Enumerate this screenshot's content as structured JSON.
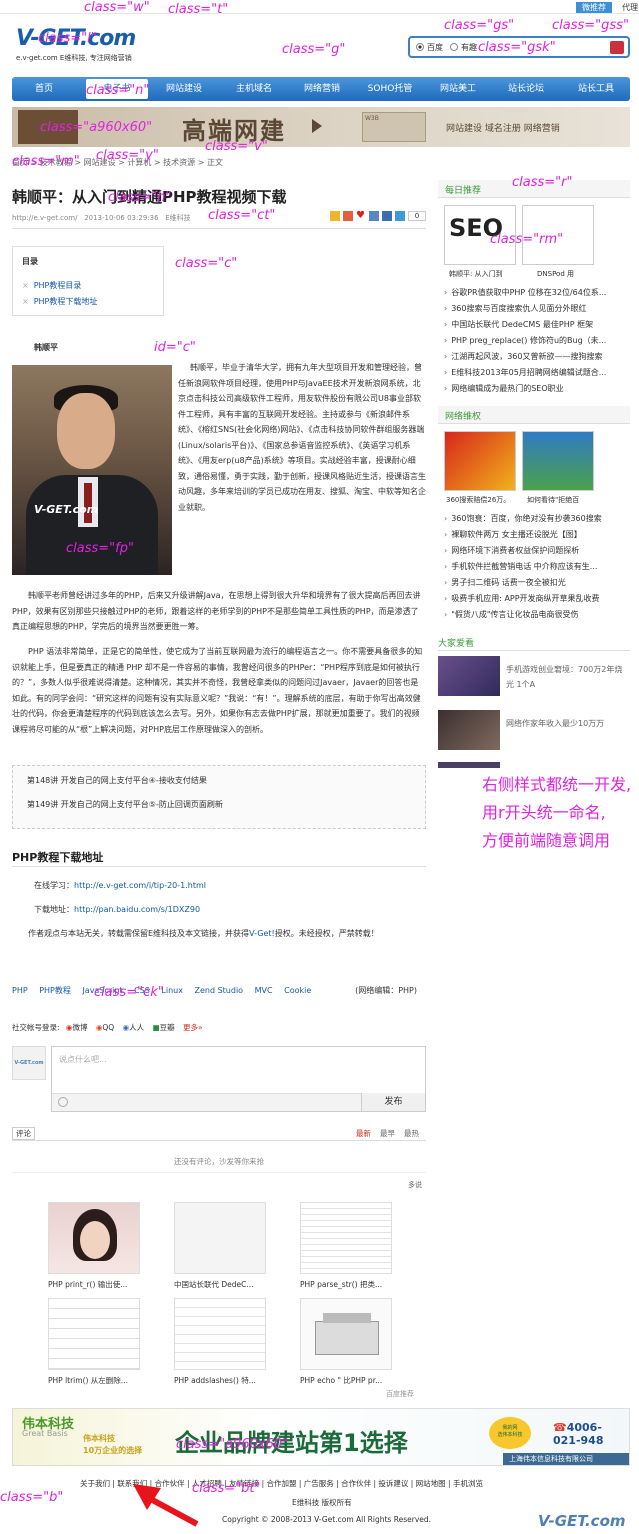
{
  "topbar": {
    "link1": "微推荐",
    "link2": "代理"
  },
  "header": {
    "logo_text": "V-GET.com",
    "tagline": "e.v-get.com E维科技, 专注网络营销",
    "search": {
      "opt1": "百度",
      "opt2": "有趣"
    }
  },
  "nav": [
    "首页",
    "电子书",
    "网站建设",
    "主机域名",
    "网络营销",
    "SOHO托管",
    "网站美工",
    "站长论坛",
    "站长工具"
  ],
  "banner": {
    "big": "高端网建",
    "small": "网站建设 域名注册 网络营销",
    "w3": "W3B"
  },
  "breadcrumb": "首页 > 技术教程 > 网站建设 > 计算机 > 技术资源 > 正文",
  "article": {
    "title": "韩顺平：从入门到精通PHP教程视频下载",
    "meta_url": "http://e.v-get.com/",
    "meta_time": "2013-10-06 03:29:36",
    "meta_source": "E维科技",
    "share_count": "0",
    "toc": {
      "heading": "目录",
      "items": [
        "PHP教程目录",
        "PHP教程下载地址"
      ]
    },
    "author": "韩顺平",
    "photo_watermark": "V-GET.com",
    "intro": "韩顺平，毕业于清华大学，拥有九年大型项目开发和管理经验，曾任新浪网软件项目经理，使用PHP与JavaEE技术开发新浪网系统，北京点击科技公司高级软件工程师，用友软件股份有限公司U8事业部软件工程师，具有丰富的互联网开发经验。主持或参与《新浪邮件系统》、《榕红SNS(社会化网络)网站》、《点击科技协同软件群组服务器端(Linux/solaris平台)》、《国家总参语音监控系统》、《英语学习机系统》、《用友erp(u8产品)系统》等项目。实战经验丰富，授课耐心细致，通俗易懂，勇于实践，勤于创新，授课风格贴近生活，授课语言生动风趣，多年来培训的学员已成功在用友、搜狐、淘宝、中软等知名企业就职。",
    "p2": "韩顺平老师曾经讲过多年的PHP，后来又升级讲解Java，在思想上得到很大升华和境界有了很大提高后再回去讲PHP，效果有区别那些只接触过PHP的老师，跟着这样的老师学到的PHP不是那些简单工具性质的PHP，而是渗透了真正编程思想的PHP，学完后的境界当然要更胜一筹。",
    "p3": "PHP 语法非常简单，正是它的简单性，使它成为了当前互联网最为流行的编程语言之一。你不需要具备很多的知识就能上手，但是要真正的精通 PHP 却不是一件容易的事情，我曾经问很多的PHPer：“PHP程序到底是如何被执行的？”，多数人似乎很难说得清楚。这种情况，其实并不奇怪，我曾经拿类似的问题问过Javaer，Javaer的回答也是如此。有的同学会问：“研究这样的问题有没有实际意义呢？”我说：“有！”。理解系统的底层，有助于你写出高效健壮的代码，你会更清楚程序的代码到底该怎么去写。另外，如果你有志去做PHP扩展，那就更加重要了。我们的视频课程将尽可能的从“根”上解决问题，对PHP底层工作原理做深入的剖析。",
    "lessons": [
      "第148讲 开发自己的网上支付平台④-接收支付结果",
      "第149讲 开发自己的网上支付平台⑤-防止回调页面刷新"
    ],
    "download_heading": "PHP教程下载地址",
    "online_label": "在线学习：",
    "online_url": "http://e.v-get.com/i/tip-20-1.html",
    "download_label": "下载地址：",
    "download_url": "http://pan.baidu.com/s/1DXZ90",
    "copyright_note_a": "作者观点与本站无关，转载需保留E维科技及本文链接，并获得",
    "copyright_note_link": "V-Get!",
    "copyright_note_b": "授权。未经授权，严禁转载！",
    "tags": [
      "PHP",
      "PHP教程",
      "JavaScript",
      "CSS",
      "Linux",
      "Zend Studio",
      "MVC",
      "Cookie"
    ],
    "editor": "(网络编辑：PHP)"
  },
  "comments": {
    "social_label": "社交帐号登录:",
    "social": [
      "微博",
      "QQ",
      "人人",
      "豆瓣",
      "更多»"
    ],
    "avatar_text": "V-GET.com",
    "placeholder": "说点什么吧...",
    "publish": "发布",
    "tab": "评论",
    "sorts": [
      "最新",
      "最早",
      "最热"
    ],
    "empty": "还没有评论，沙发等你来抢",
    "more": "多说"
  },
  "related": [
    "PHP print_r() 输出使...",
    "中国站长联代 DedeC...",
    "PHP parse_str() 把类...",
    "PHP ltrim() 从左删除...",
    "PHP addslashes() 特...",
    "PHP echo \" 比PHP pr..."
  ],
  "baidu_rec": "百度推荐",
  "sidebar": {
    "daily_head": "每日推荐",
    "daily_thumbs": [
      "韩顺平: 从入门到",
      "DNSPod 用"
    ],
    "seo_text": "SEO",
    "daily_items": [
      "谷歌PR值获取中PHP 位移在32位/64位系...",
      "360搜索与百度搜索仇人见面分外眼红",
      "中国站长联代 DedeCMS 最佳PHP 框架",
      "PHP preg_replace() 修饰符u的Bug（未...",
      "江湖再起风波，360又曾新欲——搜狗搜索",
      "E维科技2013年05月招聘网络编辑试题合...",
      "网络编辑成为最热门的SEO职业"
    ],
    "rights_head": "网络维权",
    "rights_thumbs": [
      "360搜索赔偿26万。",
      "如何看待\"拒绝百"
    ],
    "rights_items": [
      "360饱衰：百度，你绝对没有抄袭360搜索",
      "裸聊软件两万 女主播还设脱光【图】",
      "网络环境下消费者权益保护问题探析",
      "手机软件拦截营销电话 中介称应该有生...",
      "男子扫二维码 话费一夜全被扣光",
      "吸费手机应用: APP开发商纵开草果乱收费",
      "\"假货八成\"传言让化妆品电商很受伤"
    ],
    "love_head": "大家爱看",
    "love_items": [
      "手机游戏创业窘境：700万2年烧光 1个A",
      "网络作家年收入最少10万万"
    ]
  },
  "footer": {
    "company": "伟本科技",
    "company_en": "Great Basis",
    "yellow": "伟本科技\n10万企业的选择",
    "slogan": "企业品牌建站第1选择",
    "seal": "我的网\n选伟本科技",
    "phone": "4006-021-948",
    "strip": "上海伟本信息科技有限公司",
    "links": "关于我们 | 联系我们 | 合作伙伴 | 人才招聘 | 友情链接 | 合作加盟 | 广告服务 | 合作伙伴 | 投诉建议 | 网站地图 | 手机浏览",
    "copy1": "E维科技  版权所有",
    "copy2": "Copyright © 2008-2013  V-Get.com  All Rights Reserved.",
    "logo": "V-GET.com"
  },
  "notes": {
    "w": "class=\"w\"",
    "t": "class=\"t\"",
    "gs": "class=\"gs\"",
    "gss": "class=\"gss\"",
    "l": "class=\"l\"",
    "g": "class=\"g\"",
    "gsk": "class=\"gsk\"",
    "n": "class=\"n\"",
    "a960x60": "class=\"a960x60\"",
    "v": "class=\"v\"",
    "m": "class=\"m\"",
    "y": "class=\"y\"",
    "r": "class=\"r\"",
    "h": "class=\"h\"",
    "ct": "class=\"ct\"",
    "rm": "class=\"rm\"",
    "c": "class=\"c\"",
    "idc": "id=\"c\"",
    "fp": "class=\"fp\"",
    "right1": "右侧样式都统一开发,",
    "right2": "用r开头统一命名,",
    "right3": "方便前端随意调用",
    "ck": "class=\"ck\"",
    "a960x60b": "class=\"a960x60\"",
    "b": "class=\"b\"",
    "bt": "class=\"bt\""
  },
  "colors": {
    "brand": "#1a5da8",
    "nav": "#2a76c6",
    "sidebar_head": "#3c9a3c",
    "annotation": "#e024e0",
    "arrow": "#e8141b"
  }
}
